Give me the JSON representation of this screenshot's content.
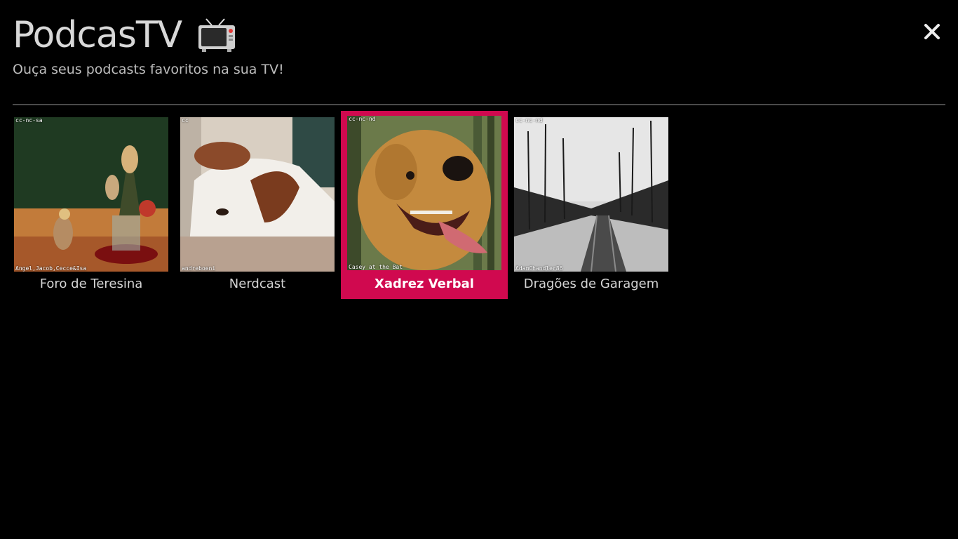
{
  "app": {
    "title": "PodcasTV",
    "subtitle": "Ouça seus podcasts favoritos na sua TV!"
  },
  "icons": {
    "app_icon": "tv-icon",
    "close": "close-icon"
  },
  "colors": {
    "background": "#000000",
    "selected": "#d0094f",
    "text": "#d8d8d8"
  },
  "podcasts": [
    {
      "title": "Foro de Teresina",
      "license": "cc-nc-sa",
      "credit": "Angel,Jacob,Cecce&Isa",
      "selected": false
    },
    {
      "title": "Nerdcast",
      "license": "cc",
      "credit": "andreboeni",
      "selected": false
    },
    {
      "title": "Xadrez Verbal",
      "license": "cc-nc-nd",
      "credit": "Casey at the Bat",
      "selected": true
    },
    {
      "title": "Dragões de Garagem",
      "license": "cc-nc-nd",
      "credit": "AdamChandler86",
      "selected": false
    }
  ]
}
